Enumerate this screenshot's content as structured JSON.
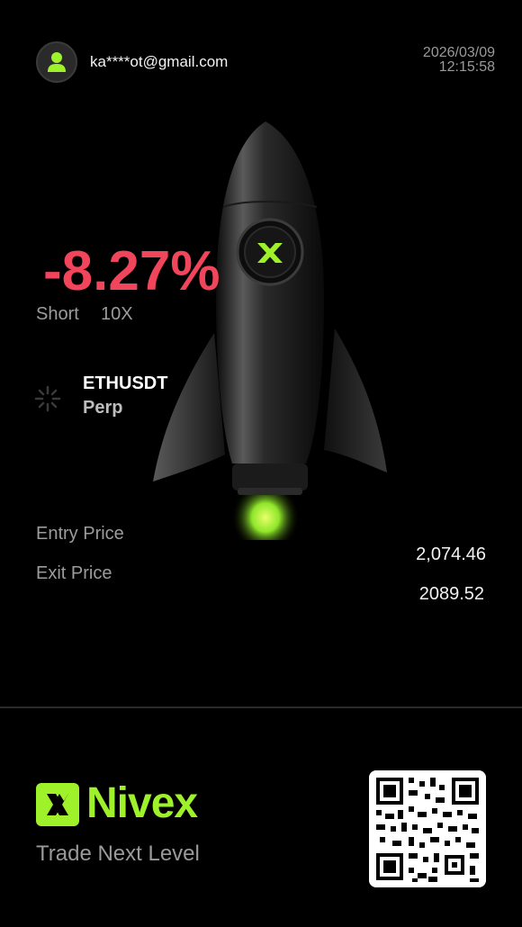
{
  "header": {
    "email": "ka****ot@gmail.com",
    "date": "2026/03/09",
    "time": "12:15:58"
  },
  "trade": {
    "pnl_percent": "-8.27%",
    "direction": "Short",
    "leverage": "10X",
    "pair": "ETHUSDT",
    "type": "Perp",
    "entry_label": "Entry Price",
    "exit_label": "Exit Price",
    "entry_price": "2,074.46",
    "exit_price": "2089.52"
  },
  "footer": {
    "brand": "Nivex",
    "tagline": "Trade Next Level"
  },
  "colors": {
    "pnl_negative": "#f0455b",
    "brand_green": "#9ff22a",
    "background": "#000000"
  },
  "icons": {
    "avatar": "user-icon",
    "loading": "spinner-icon",
    "logo": "nivex-logo-icon",
    "qr": "qr-code"
  }
}
